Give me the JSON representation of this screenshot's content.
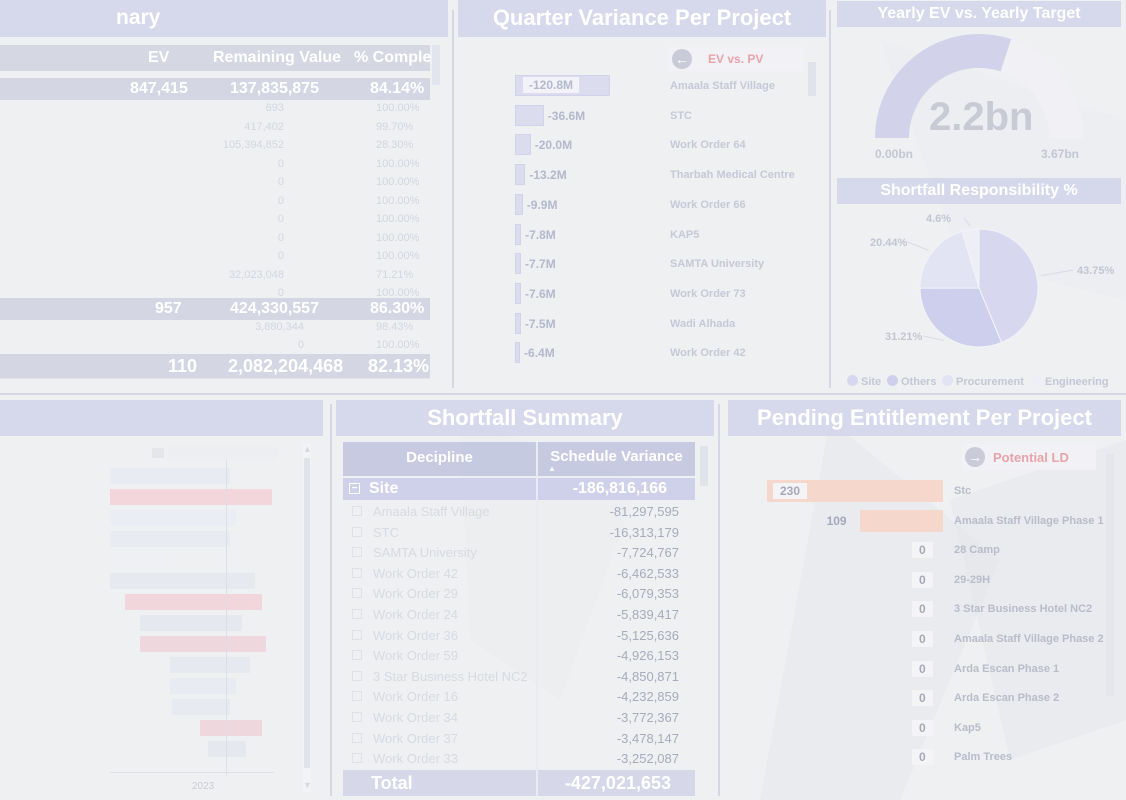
{
  "colors": {
    "title_bg": "#cdd0e8",
    "variance_bar": "#dcdcef",
    "entitlement_bar": "#f6d7cc",
    "pie_site": "#d7d8ef",
    "pie_others": "#cdcfec",
    "pie_procurement": "#e2e3f3",
    "pie_engineering": "#eeeef7"
  },
  "progress_panel": {
    "title_fragment": "nary",
    "headers": {
      "ev": "EV",
      "remaining": "Remaining Value",
      "complete": "% Comple"
    },
    "top_total": {
      "ev": "847,415",
      "remaining": "137,835,875",
      "complete": "84.14%"
    },
    "rows": [
      {
        "remaining": "693",
        "complete": "100.00%"
      },
      {
        "remaining": "417,402",
        "complete": "99.70%"
      },
      {
        "remaining": "105,394,852",
        "complete": "28.30%"
      },
      {
        "remaining": "0",
        "complete": "100.00%"
      },
      {
        "remaining": "0",
        "complete": "100.00%"
      },
      {
        "remaining": "0",
        "complete": "100.00%"
      },
      {
        "remaining": "0",
        "complete": "100.00%"
      },
      {
        "remaining": "0",
        "complete": "100.00%"
      },
      {
        "remaining": "0",
        "complete": "100.00%"
      },
      {
        "remaining": "32,023,048",
        "complete": "71.21%"
      },
      {
        "remaining": "0",
        "complete": "100.00%"
      }
    ],
    "mid_total": {
      "ev": "957",
      "remaining": "424,330,557",
      "complete": "86.30%"
    },
    "rows2": [
      {
        "remaining": "3,880,344",
        "complete": "98.43%"
      },
      {
        "remaining": "0",
        "complete": "100.00%"
      }
    ],
    "grand_total": {
      "ev": "110",
      "remaining": "2,082,204,468",
      "complete": "82.13%"
    }
  },
  "quarter_variance": {
    "title": "Quarter Variance Per Project",
    "nav_label": "EV vs. PV",
    "items": [
      {
        "label": "Amaala Staff Village",
        "value": -120.8,
        "display": "-120.8M"
      },
      {
        "label": "STC",
        "value": -36.6,
        "display": "-36.6M"
      },
      {
        "label": "Work Order 64",
        "value": -20.0,
        "display": "-20.0M"
      },
      {
        "label": "Tharbah Medical Centre",
        "value": -13.2,
        "display": "-13.2M"
      },
      {
        "label": "Work Order 66",
        "value": -9.9,
        "display": "-9.9M"
      },
      {
        "label": "KAP5",
        "value": -7.8,
        "display": "-7.8M"
      },
      {
        "label": "SAMTA University",
        "value": -7.7,
        "display": "-7.7M"
      },
      {
        "label": "Work Order 73",
        "value": -7.6,
        "display": "-7.6M"
      },
      {
        "label": "Wadi Alhada",
        "value": -7.5,
        "display": "-7.5M"
      },
      {
        "label": "Work Order 42",
        "value": -6.4,
        "display": "-6.4M"
      }
    ]
  },
  "yearly_ev": {
    "title": "Yearly EV vs. Yearly Target",
    "value": "2.2bn",
    "min": "0.00bn",
    "max": "3.67bn",
    "fraction": 0.6
  },
  "shortfall_resp": {
    "title": "Shortfall Responsibility %",
    "slices": [
      {
        "name": "Site",
        "pct": 43.75,
        "label": "43.75%"
      },
      {
        "name": "Others",
        "pct": 31.21,
        "label": "31.21%"
      },
      {
        "name": "Procurement",
        "pct": 20.44,
        "label": "20.44%"
      },
      {
        "name": "Engineering",
        "pct": 4.6,
        "label": "4.6%"
      }
    ]
  },
  "schedule_panel": {
    "axis_label": "2023"
  },
  "shortfall_summary": {
    "title": "Shortfall Summary",
    "col1": "Decipline",
    "col2": "Schedule Variance",
    "group": {
      "name": "Site",
      "value": "-186,816,166"
    },
    "rows": [
      {
        "name": "Amaala Staff Village",
        "value": "-81,297,595"
      },
      {
        "name": "STC",
        "value": "-16,313,179"
      },
      {
        "name": "SAMTA University",
        "value": "-7,724,767"
      },
      {
        "name": "Work Order 42",
        "value": "-6,462,533"
      },
      {
        "name": "Work Order 29",
        "value": "-6,079,353"
      },
      {
        "name": "Work Order 24",
        "value": "-5,839,417"
      },
      {
        "name": "Work Order 36",
        "value": "-5,125,636"
      },
      {
        "name": "Work Order 59",
        "value": "-4,926,153"
      },
      {
        "name": "3 Star Business Hotel NC2",
        "value": "-4,850,871"
      },
      {
        "name": "Work Order 16",
        "value": "-4,232,859"
      },
      {
        "name": "Work Order 34",
        "value": "-3,772,367"
      },
      {
        "name": "Work Order 37",
        "value": "-3,478,147"
      },
      {
        "name": "Work Order 33",
        "value": "-3,252,087"
      }
    ],
    "total": {
      "name": "Total",
      "value": "-427,021,653"
    }
  },
  "pending_entitlement": {
    "title": "Pending Entitlement Per Project",
    "nav_label": "Potential LD",
    "items": [
      {
        "label": "Stc",
        "value": 230
      },
      {
        "label": "Amaala Staff Village Phase 1",
        "value": 109
      },
      {
        "label": "28 Camp",
        "value": 0
      },
      {
        "label": "29-29H",
        "value": 0
      },
      {
        "label": "3 Star Business Hotel NC2",
        "value": 0
      },
      {
        "label": "Amaala Staff Village Phase 2",
        "value": 0
      },
      {
        "label": "Arda Escan Phase 1",
        "value": 0
      },
      {
        "label": "Arda Escan Phase 2",
        "value": 0
      },
      {
        "label": "Kap5",
        "value": 0
      },
      {
        "label": "Palm Trees",
        "value": 0
      }
    ]
  }
}
